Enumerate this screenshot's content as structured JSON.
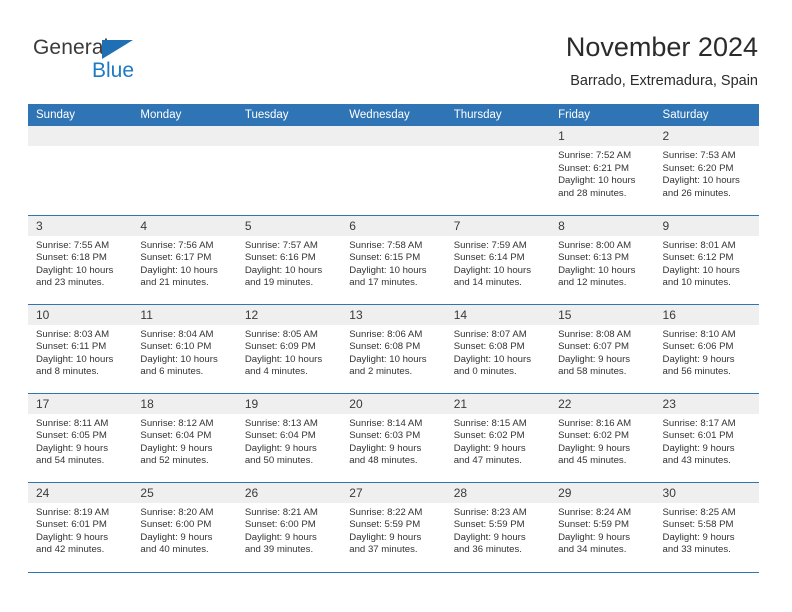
{
  "brand": {
    "name_top": "General",
    "name_bottom": "Blue",
    "accent_color": "#1f7ac4",
    "triangle_color": "#1f6fb5"
  },
  "header": {
    "title": "November 2024",
    "subtitle": "Barrado, Extremadura, Spain"
  },
  "calendar": {
    "header_bg": "#2f74b5",
    "daynum_bg": "#efefef",
    "weekdays": [
      "Sunday",
      "Monday",
      "Tuesday",
      "Wednesday",
      "Thursday",
      "Friday",
      "Saturday"
    ],
    "weeks": [
      [
        {
          "day": "",
          "empty": true
        },
        {
          "day": "",
          "empty": true
        },
        {
          "day": "",
          "empty": true
        },
        {
          "day": "",
          "empty": true
        },
        {
          "day": "",
          "empty": true
        },
        {
          "day": "1",
          "sunrise": "Sunrise: 7:52 AM",
          "sunset": "Sunset: 6:21 PM",
          "daylight": "Daylight: 10 hours and 28 minutes."
        },
        {
          "day": "2",
          "sunrise": "Sunrise: 7:53 AM",
          "sunset": "Sunset: 6:20 PM",
          "daylight": "Daylight: 10 hours and 26 minutes."
        }
      ],
      [
        {
          "day": "3",
          "sunrise": "Sunrise: 7:55 AM",
          "sunset": "Sunset: 6:18 PM",
          "daylight": "Daylight: 10 hours and 23 minutes."
        },
        {
          "day": "4",
          "sunrise": "Sunrise: 7:56 AM",
          "sunset": "Sunset: 6:17 PM",
          "daylight": "Daylight: 10 hours and 21 minutes."
        },
        {
          "day": "5",
          "sunrise": "Sunrise: 7:57 AM",
          "sunset": "Sunset: 6:16 PM",
          "daylight": "Daylight: 10 hours and 19 minutes."
        },
        {
          "day": "6",
          "sunrise": "Sunrise: 7:58 AM",
          "sunset": "Sunset: 6:15 PM",
          "daylight": "Daylight: 10 hours and 17 minutes."
        },
        {
          "day": "7",
          "sunrise": "Sunrise: 7:59 AM",
          "sunset": "Sunset: 6:14 PM",
          "daylight": "Daylight: 10 hours and 14 minutes."
        },
        {
          "day": "8",
          "sunrise": "Sunrise: 8:00 AM",
          "sunset": "Sunset: 6:13 PM",
          "daylight": "Daylight: 10 hours and 12 minutes."
        },
        {
          "day": "9",
          "sunrise": "Sunrise: 8:01 AM",
          "sunset": "Sunset: 6:12 PM",
          "daylight": "Daylight: 10 hours and 10 minutes."
        }
      ],
      [
        {
          "day": "10",
          "sunrise": "Sunrise: 8:03 AM",
          "sunset": "Sunset: 6:11 PM",
          "daylight": "Daylight: 10 hours and 8 minutes."
        },
        {
          "day": "11",
          "sunrise": "Sunrise: 8:04 AM",
          "sunset": "Sunset: 6:10 PM",
          "daylight": "Daylight: 10 hours and 6 minutes."
        },
        {
          "day": "12",
          "sunrise": "Sunrise: 8:05 AM",
          "sunset": "Sunset: 6:09 PM",
          "daylight": "Daylight: 10 hours and 4 minutes."
        },
        {
          "day": "13",
          "sunrise": "Sunrise: 8:06 AM",
          "sunset": "Sunset: 6:08 PM",
          "daylight": "Daylight: 10 hours and 2 minutes."
        },
        {
          "day": "14",
          "sunrise": "Sunrise: 8:07 AM",
          "sunset": "Sunset: 6:08 PM",
          "daylight": "Daylight: 10 hours and 0 minutes."
        },
        {
          "day": "15",
          "sunrise": "Sunrise: 8:08 AM",
          "sunset": "Sunset: 6:07 PM",
          "daylight": "Daylight: 9 hours and 58 minutes."
        },
        {
          "day": "16",
          "sunrise": "Sunrise: 8:10 AM",
          "sunset": "Sunset: 6:06 PM",
          "daylight": "Daylight: 9 hours and 56 minutes."
        }
      ],
      [
        {
          "day": "17",
          "sunrise": "Sunrise: 8:11 AM",
          "sunset": "Sunset: 6:05 PM",
          "daylight": "Daylight: 9 hours and 54 minutes."
        },
        {
          "day": "18",
          "sunrise": "Sunrise: 8:12 AM",
          "sunset": "Sunset: 6:04 PM",
          "daylight": "Daylight: 9 hours and 52 minutes."
        },
        {
          "day": "19",
          "sunrise": "Sunrise: 8:13 AM",
          "sunset": "Sunset: 6:04 PM",
          "daylight": "Daylight: 9 hours and 50 minutes."
        },
        {
          "day": "20",
          "sunrise": "Sunrise: 8:14 AM",
          "sunset": "Sunset: 6:03 PM",
          "daylight": "Daylight: 9 hours and 48 minutes."
        },
        {
          "day": "21",
          "sunrise": "Sunrise: 8:15 AM",
          "sunset": "Sunset: 6:02 PM",
          "daylight": "Daylight: 9 hours and 47 minutes."
        },
        {
          "day": "22",
          "sunrise": "Sunrise: 8:16 AM",
          "sunset": "Sunset: 6:02 PM",
          "daylight": "Daylight: 9 hours and 45 minutes."
        },
        {
          "day": "23",
          "sunrise": "Sunrise: 8:17 AM",
          "sunset": "Sunset: 6:01 PM",
          "daylight": "Daylight: 9 hours and 43 minutes."
        }
      ],
      [
        {
          "day": "24",
          "sunrise": "Sunrise: 8:19 AM",
          "sunset": "Sunset: 6:01 PM",
          "daylight": "Daylight: 9 hours and 42 minutes."
        },
        {
          "day": "25",
          "sunrise": "Sunrise: 8:20 AM",
          "sunset": "Sunset: 6:00 PM",
          "daylight": "Daylight: 9 hours and 40 minutes."
        },
        {
          "day": "26",
          "sunrise": "Sunrise: 8:21 AM",
          "sunset": "Sunset: 6:00 PM",
          "daylight": "Daylight: 9 hours and 39 minutes."
        },
        {
          "day": "27",
          "sunrise": "Sunrise: 8:22 AM",
          "sunset": "Sunset: 5:59 PM",
          "daylight": "Daylight: 9 hours and 37 minutes."
        },
        {
          "day": "28",
          "sunrise": "Sunrise: 8:23 AM",
          "sunset": "Sunset: 5:59 PM",
          "daylight": "Daylight: 9 hours and 36 minutes."
        },
        {
          "day": "29",
          "sunrise": "Sunrise: 8:24 AM",
          "sunset": "Sunset: 5:59 PM",
          "daylight": "Daylight: 9 hours and 34 minutes."
        },
        {
          "day": "30",
          "sunrise": "Sunrise: 8:25 AM",
          "sunset": "Sunset: 5:58 PM",
          "daylight": "Daylight: 9 hours and 33 minutes."
        }
      ]
    ]
  }
}
